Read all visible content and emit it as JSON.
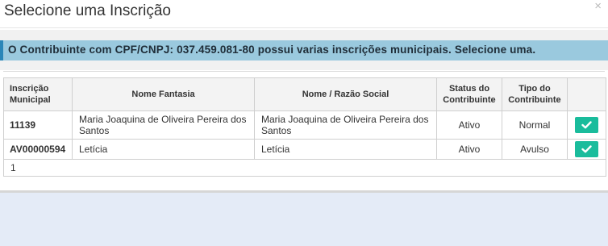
{
  "modal": {
    "title": "Selecione uma Inscrição",
    "close_label": "×"
  },
  "info": {
    "message": "O Contribuinte com CPF/CNPJ: 037.459.081-80 possui varias inscrições municipais. Selecione uma."
  },
  "table": {
    "columns": [
      "Inscrição Municipal",
      "Nome Fantasia",
      "Nome / Razão Social",
      "Status do Contribuinte",
      "Tipo do Contribuinte",
      ""
    ],
    "rows": [
      {
        "inscricao": "11139",
        "nome_fantasia": "Maria Joaquina de Oliveira Pereira dos Santos",
        "razao_social": "Maria Joaquina de Oliveira Pereira dos Santos",
        "status": "Ativo",
        "tipo": "Normal",
        "action_icon": "check-icon"
      },
      {
        "inscricao": "AV00000594",
        "nome_fantasia": "Letícia",
        "razao_social": "Letícia",
        "status": "Ativo",
        "tipo": "Avulso",
        "action_icon": "check-icon"
      }
    ],
    "footer_page": "1"
  },
  "colors": {
    "info_bg": "#9ac9de",
    "info_accent": "#2a86b8",
    "select_button": "#1abc9c",
    "backdrop": "#e4ebf7"
  }
}
